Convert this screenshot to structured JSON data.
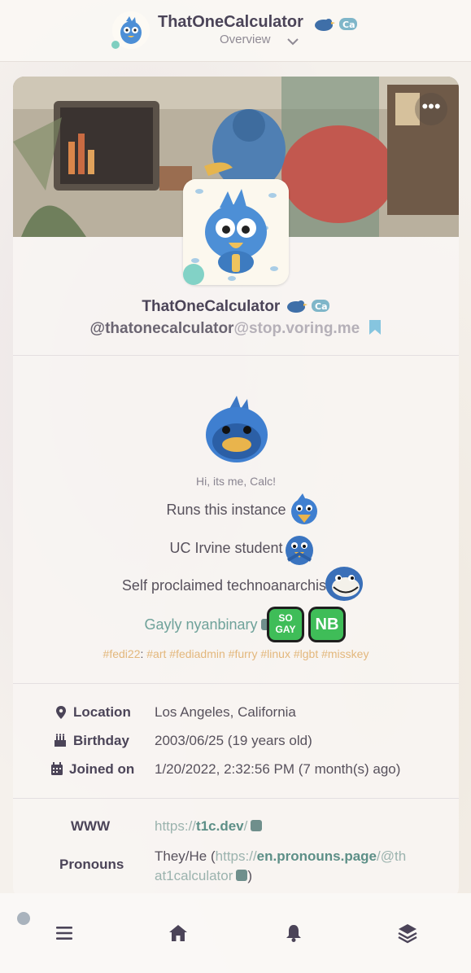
{
  "header": {
    "title": "ThatOneCalculator",
    "subtitle": "Overview"
  },
  "profile": {
    "display_name": "ThatOneCalculator",
    "handle_user": "@thatonecalculator",
    "handle_host": "@stop.voring.me",
    "more_label": "•••"
  },
  "bio": {
    "greeting": "Hi, its me, Calc!",
    "line1": "Runs this instance",
    "line2": "UC Irvine student",
    "line3": "Self proclaimed technoanarchist",
    "line4": "Gayly nyanbinary",
    "badge_sogay_top": "SO",
    "badge_sogay_bottom": "GAY",
    "badge_nb": "NB",
    "tags": [
      "#fedi22",
      "#art",
      "#fediadmin",
      "#furry",
      "#linux",
      "#lgbt",
      "#misskey"
    ]
  },
  "fields": {
    "location_label": "Location",
    "location_value": "Los Angeles, California",
    "birthday_label": "Birthday",
    "birthday_value": "2003/06/25 (19 years old)",
    "joined_label": "Joined on",
    "joined_value": "1/20/2022, 2:32:56 PM (7 month(s) ago)",
    "www_label": "WWW",
    "www_scheme": "https://",
    "www_host": "t1c.dev",
    "www_path": "/",
    "pronouns_label": "Pronouns",
    "pronouns_prefix": "They/He (",
    "pronouns_scheme": "https://",
    "pronouns_host": "en.pronouns.page",
    "pronouns_path_a": "/@th",
    "pronouns_path_b": "at1calculator",
    "pronouns_suffix": ")"
  },
  "colors": {
    "accent": "#5d8f87",
    "online": "#82d2c6",
    "hashtag": "#e3b77c",
    "badge_green": "#3fbd58"
  },
  "icons": {
    "nav": [
      "menu-icon",
      "home-icon",
      "bell-icon",
      "layers-icon"
    ]
  }
}
